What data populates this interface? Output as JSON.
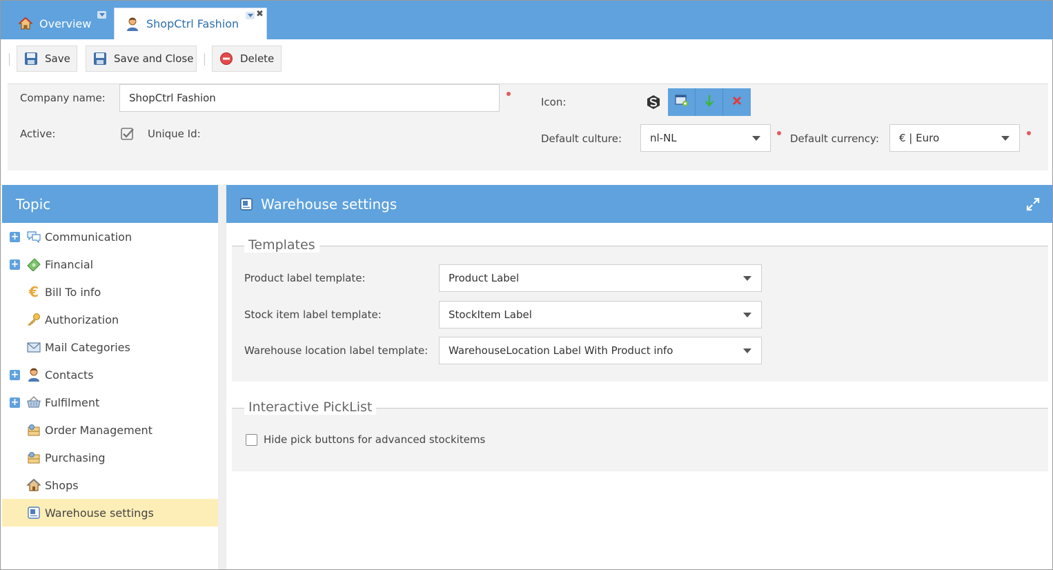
{
  "tabs": [
    {
      "label": "Overview",
      "icon": "home-icon"
    },
    {
      "label": "ShopCtrl Fashion",
      "icon": "user-icon",
      "active": true
    }
  ],
  "toolbar": {
    "save_label": "Save",
    "save_close_label": "Save and Close",
    "delete_label": "Delete"
  },
  "company": {
    "name_label": "Company name:",
    "name_value": "ShopCtrl Fashion",
    "active_label": "Active:",
    "active_checked": true,
    "unique_id_label": "Unique Id:",
    "icon_label": "Icon:",
    "culture_label": "Default culture:",
    "culture_value": "nl-NL",
    "currency_label": "Default currency:",
    "currency_value": "€ | Euro"
  },
  "topic": {
    "title": "Topic",
    "items": [
      {
        "label": "Communication",
        "icon": "speech-bubbles-icon",
        "expandable": true
      },
      {
        "label": "Financial",
        "icon": "money-icon",
        "expandable": true
      },
      {
        "label": "Bill To info",
        "icon": "euro-icon",
        "expandable": false
      },
      {
        "label": "Authorization",
        "icon": "key-icon",
        "expandable": false
      },
      {
        "label": "Mail Categories",
        "icon": "mail-icon",
        "expandable": false
      },
      {
        "label": "Contacts",
        "icon": "user-icon",
        "expandable": true
      },
      {
        "label": "Fulfilment",
        "icon": "basket-icon",
        "expandable": true
      },
      {
        "label": "Order Management",
        "icon": "order-icon",
        "expandable": false
      },
      {
        "label": "Purchasing",
        "icon": "order-icon",
        "expandable": false
      },
      {
        "label": "Shops",
        "icon": "shop-icon",
        "expandable": false
      },
      {
        "label": "Warehouse settings",
        "icon": "document-icon",
        "expandable": false,
        "selected": true
      }
    ]
  },
  "warehouse": {
    "title": "Warehouse settings",
    "templates_legend": "Templates",
    "product_label_label": "Product label template:",
    "product_label_value": "Product Label",
    "stock_label_label": "Stock item label template:",
    "stock_label_value": "StockItem Label",
    "location_label_label": "Warehouse location label template:",
    "location_label_value": "WarehouseLocation Label With Product info",
    "picklist_legend": "Interactive PickList",
    "hide_pick_label": "Hide pick buttons for advanced stockitems",
    "hide_pick_checked": false
  },
  "colors": {
    "header_blue": "#5fa2dd",
    "selected_row": "#fdeeb7",
    "required_dot": "#e25b5b"
  }
}
